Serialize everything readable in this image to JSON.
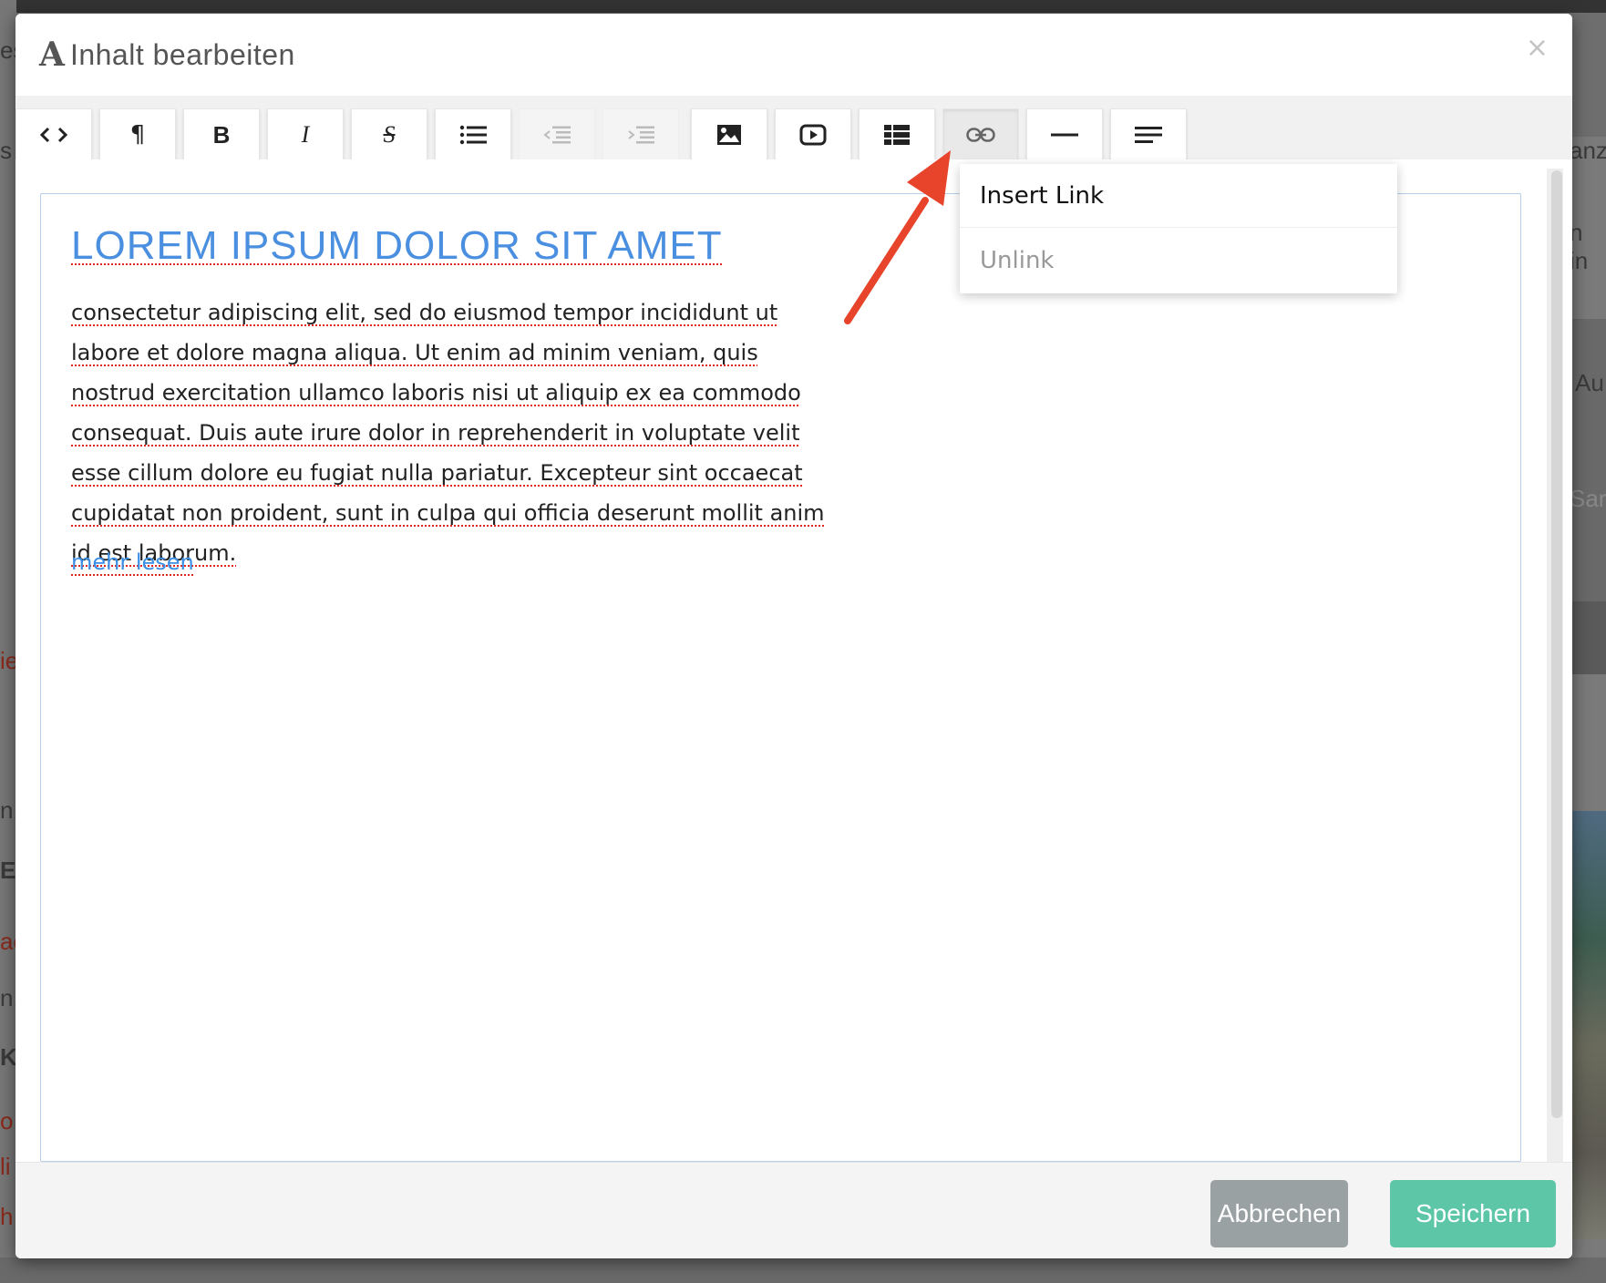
{
  "modal": {
    "title": "Inhalt bearbeiten",
    "title_icon": "A",
    "close_label": "×"
  },
  "toolbar": {
    "buttons": [
      {
        "name": "code-view",
        "glyph": "<>",
        "state": "normal"
      },
      {
        "name": "paragraph",
        "glyph": "¶",
        "state": "normal"
      },
      {
        "name": "bold",
        "glyph": "B",
        "state": "normal"
      },
      {
        "name": "italic",
        "glyph": "I",
        "state": "normal"
      },
      {
        "name": "strikethrough",
        "glyph": "S",
        "state": "normal"
      },
      {
        "name": "unordered-list",
        "glyph": "list-icon",
        "state": "normal"
      },
      {
        "name": "outdent",
        "glyph": "outdent-icon",
        "state": "disabled"
      },
      {
        "name": "indent",
        "glyph": "indent-icon",
        "state": "disabled"
      },
      {
        "name": "image",
        "glyph": "image-icon",
        "state": "normal"
      },
      {
        "name": "video",
        "glyph": "video-icon",
        "state": "normal"
      },
      {
        "name": "table",
        "glyph": "table-icon",
        "state": "normal"
      },
      {
        "name": "link",
        "glyph": "link-icon",
        "state": "active"
      },
      {
        "name": "horizontal-rule",
        "glyph": "hr-icon",
        "state": "normal"
      },
      {
        "name": "alignment",
        "glyph": "align-icon",
        "state": "normal"
      }
    ]
  },
  "editor": {
    "heading": "LOREM IPSUM DOLOR SIT AMET",
    "body": "consectetur adipiscing elit, sed do eiusmod tempor incididunt ut labore et dolore magna aliqua. Ut enim ad minim veniam, quis nostrud exercitation ullamco laboris nisi ut aliquip ex ea commodo consequat. Duis aute irure dolor in reprehenderit in voluptate velit esse cillum dolore eu fugiat nulla pariatur. Excepteur sint occaecat cupidatat non proident, sunt in culpa qui officia deserunt mollit anim id est laborum.",
    "more_link": "mehr lesen"
  },
  "link_menu": {
    "insert_label": "Insert Link",
    "unlink_label": "Unlink"
  },
  "footer": {
    "cancel_label": "Abbrechen",
    "save_label": "Speichern"
  },
  "background_fragments": {
    "top_left": "es",
    "left_1": "s",
    "right_1": "anz",
    "right_2": "n in",
    "right_3": "Au",
    "right_4": "Sar",
    "left_2": "ie",
    "left_3": "n.",
    "left_4": "EN",
    "left_5": "ac",
    "left_6": "n..",
    "left_7": "KT",
    "left_8": "o",
    "left_9": "li",
    "left_10": "h"
  },
  "colors": {
    "heading": "#4a8fe0",
    "link": "#3a8ee6",
    "spellcheck": "#e0261c",
    "save_button": "#5cc6a7",
    "cancel_button": "#99a1a3",
    "annotation_arrow": "#e8432b"
  }
}
